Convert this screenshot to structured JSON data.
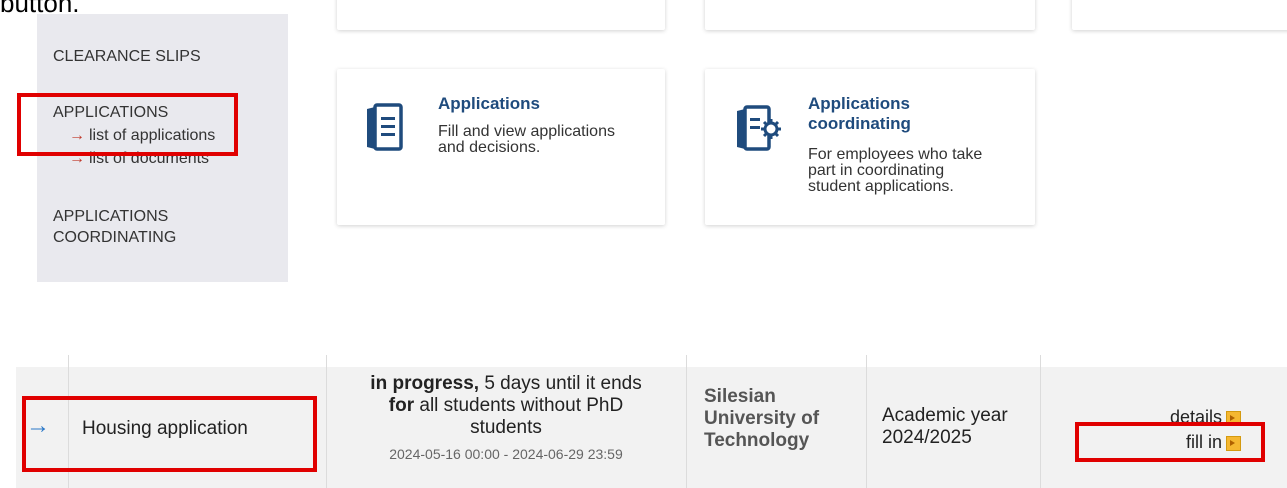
{
  "instruction_fragment": "button.",
  "sidebar": {
    "clearance": "CLEARANCE SLIPS",
    "applications": "APPLICATIONS",
    "sub_items": [
      {
        "label": "list of applications"
      },
      {
        "label": "list of documents"
      }
    ],
    "coordinating_line1": "APPLICATIONS",
    "coordinating_line2": "COORDINATING"
  },
  "tiles": [
    {
      "title": "Applications",
      "desc_lines": [
        "Fill and view applications",
        "and decisions."
      ],
      "icon": "document-icon"
    },
    {
      "title_lines": [
        "Applications",
        "coordinating"
      ],
      "desc_lines": [
        "For employees who take",
        "part in coordinating",
        "student applications."
      ],
      "icon": "document-gear-icon"
    }
  ],
  "table": {
    "row_arrow": "→",
    "name": "Housing application",
    "status_bold": "in progress,",
    "status_rest": "5 days until it ends",
    "for_bold": "for",
    "for_rest": "all students without PhD",
    "for_rest2": "students",
    "dates": "2024-05-16 00:00 - 2024-06-29 23:59",
    "institution_lines": [
      "Silesian",
      "University of",
      "Technology"
    ],
    "year_lines": [
      "Academic year",
      "2024/2025"
    ],
    "link_details": "details",
    "link_fill": "fill in"
  },
  "colors": {
    "highlight": "#e00000",
    "link_blue": "#1f4b7d",
    "arrow_blue": "#2a78c8"
  }
}
